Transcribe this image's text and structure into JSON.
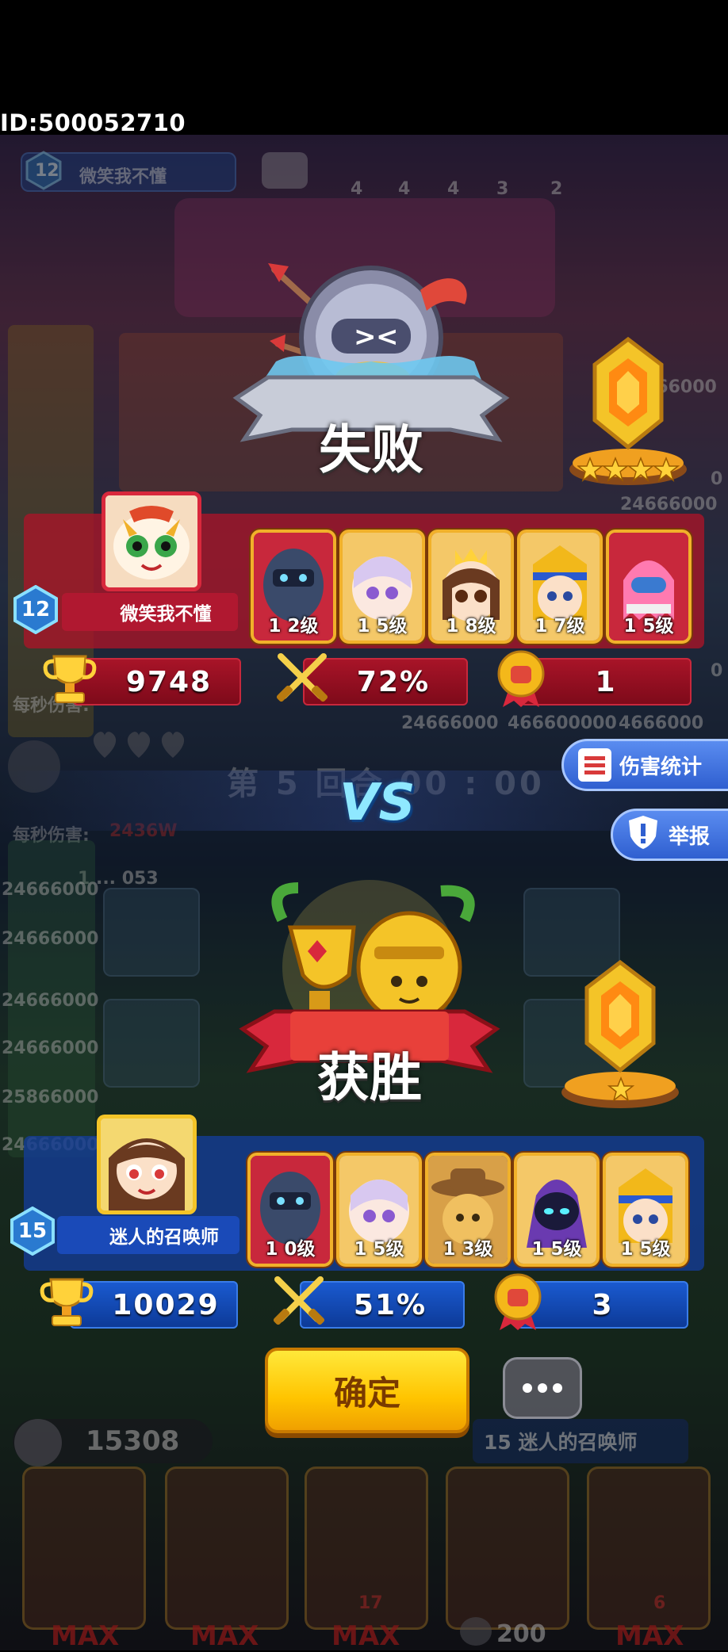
{
  "user_id": "ID:500052710",
  "background": {
    "player_level": "12",
    "player_name": "微笑我不懂",
    "star_counts": [
      "4",
      "4",
      "4",
      "3",
      "2"
    ],
    "tile_values": [
      "24666000",
      "24666000",
      "24666000",
      "24666000",
      "25866000",
      "24666000"
    ],
    "right_values": [
      "466000",
      "0",
      "24666000",
      "0"
    ],
    "mid_values": [
      "24666000",
      "466600000",
      "4666000"
    ],
    "dps_text": "每秒伤害:",
    "round_text": "第 5 回合 00 : 00",
    "dps_value": "2436W",
    "misc_value": "1 ... 053",
    "bottom_left_value": "15308",
    "bottom_bar_value": "15 迷人的召唤师",
    "bottom_small_value": "200",
    "max_labels": [
      "MAX",
      "MAX",
      "MAX",
      "MAX"
    ],
    "card_nums": [
      "17",
      "6"
    ]
  },
  "loser": {
    "result_label": "失败",
    "level": "12",
    "name": "微笑我不懂",
    "trophies": "9748",
    "win_rate": "72%",
    "rank": "1",
    "crystal_stars": 4,
    "heroes": [
      {
        "level": "1 2级",
        "icon": "dark-knight-hero"
      },
      {
        "level": "1 5级",
        "icon": "white-angel-hero"
      },
      {
        "level": "1 8级",
        "icon": "princess-hero"
      },
      {
        "level": "1 7级",
        "icon": "pharaoh-hero"
      },
      {
        "level": "1 5级",
        "icon": "pink-ghost-hero"
      }
    ]
  },
  "winner": {
    "result_label": "获胜",
    "level": "15",
    "name": "迷人的召唤师",
    "trophies": "10029",
    "win_rate": "51%",
    "rank": "3",
    "crystal_stars": 1,
    "heroes": [
      {
        "level": "1 0级",
        "icon": "dark-knight-hero"
      },
      {
        "level": "1 5级",
        "icon": "white-angel-hero"
      },
      {
        "level": "1 3级",
        "icon": "cowboy-hero"
      },
      {
        "level": "1 5级",
        "icon": "purple-mage-hero"
      },
      {
        "level": "1 5级",
        "icon": "pharaoh-hero"
      }
    ]
  },
  "vs_label": "VS",
  "buttons": {
    "damage_stats": "伤害统计",
    "report": "举报",
    "confirm": "确定"
  },
  "colors": {
    "loser_panel": "#a81428",
    "winner_panel": "#1a5ad0",
    "confirm_button": "#ffc400",
    "gold": "#f1b12a"
  }
}
